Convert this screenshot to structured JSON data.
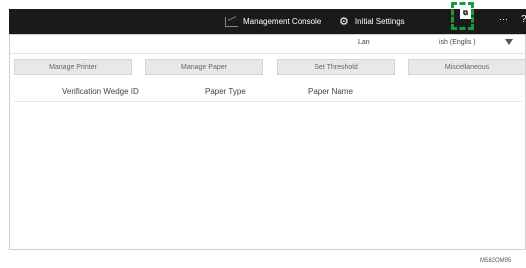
{
  "topbar": {
    "management_console": "Management Console",
    "initial_settings": "Initial Settings",
    "more": "···",
    "help": "?",
    "switch_icon_text": "⧉"
  },
  "language": {
    "label": "Lan",
    "value": "ish (Englis )"
  },
  "tabs": [
    "Manage Printer",
    "Manage Paper",
    "Set Threshold",
    "Miscellaneous"
  ],
  "table": {
    "columns": [
      "Verification Wedge ID",
      "Paper Type",
      "Paper Name"
    ]
  },
  "figure_id": "M582OM95"
}
